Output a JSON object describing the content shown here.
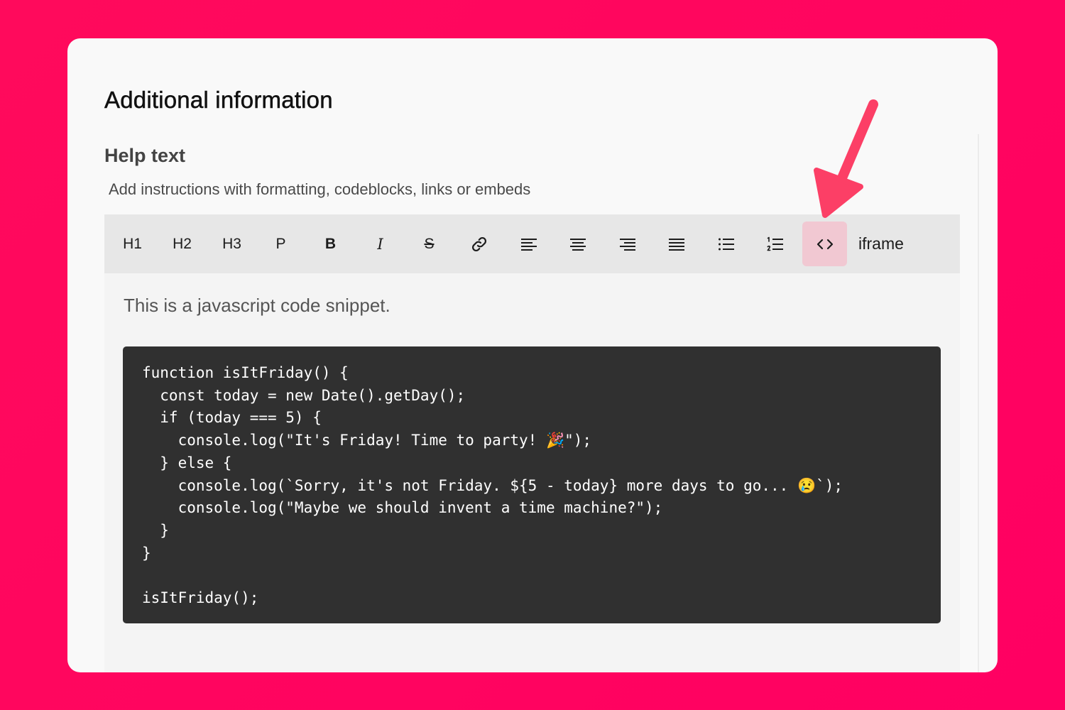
{
  "colors": {
    "background": "#ff0762",
    "card": "#f9f9f9",
    "toolbar": "#e7e7e7",
    "toolbar_active": "#f1c8d2",
    "code_background": "#303030",
    "arrow": "#fc3f66"
  },
  "section": {
    "title": "Additional information"
  },
  "field": {
    "label": "Help text",
    "description": "Add instructions with formatting, codeblocks, links or embeds"
  },
  "toolbar": {
    "h1": "H1",
    "h2": "H2",
    "h3": "H3",
    "p": "P",
    "bold": "B",
    "italic": "I",
    "strike": "S",
    "link_icon": "link-icon",
    "align_left_icon": "align-left-icon",
    "align_center_icon": "align-center-icon",
    "align_right_icon": "align-right-icon",
    "align_justify_icon": "align-justify-icon",
    "bullet_list_icon": "bullet-list-icon",
    "ordered_list_icon": "ordered-list-icon",
    "code_icon": "code-icon",
    "code_active": true,
    "iframe": "iframe"
  },
  "editor": {
    "paragraph": "This is a javascript code snippet.",
    "code": "function isItFriday() {\n  const today = new Date().getDay();\n  if (today === 5) {\n    console.log(\"It's Friday! Time to party! 🎉\");\n  } else {\n    console.log(`Sorry, it's not Friday. ${5 - today} more days to go... 😢`);\n    console.log(\"Maybe we should invent a time machine?\");\n  }\n}\n\nisItFriday();"
  },
  "annotation": {
    "arrow_icon": "arrow-pointer-icon"
  }
}
